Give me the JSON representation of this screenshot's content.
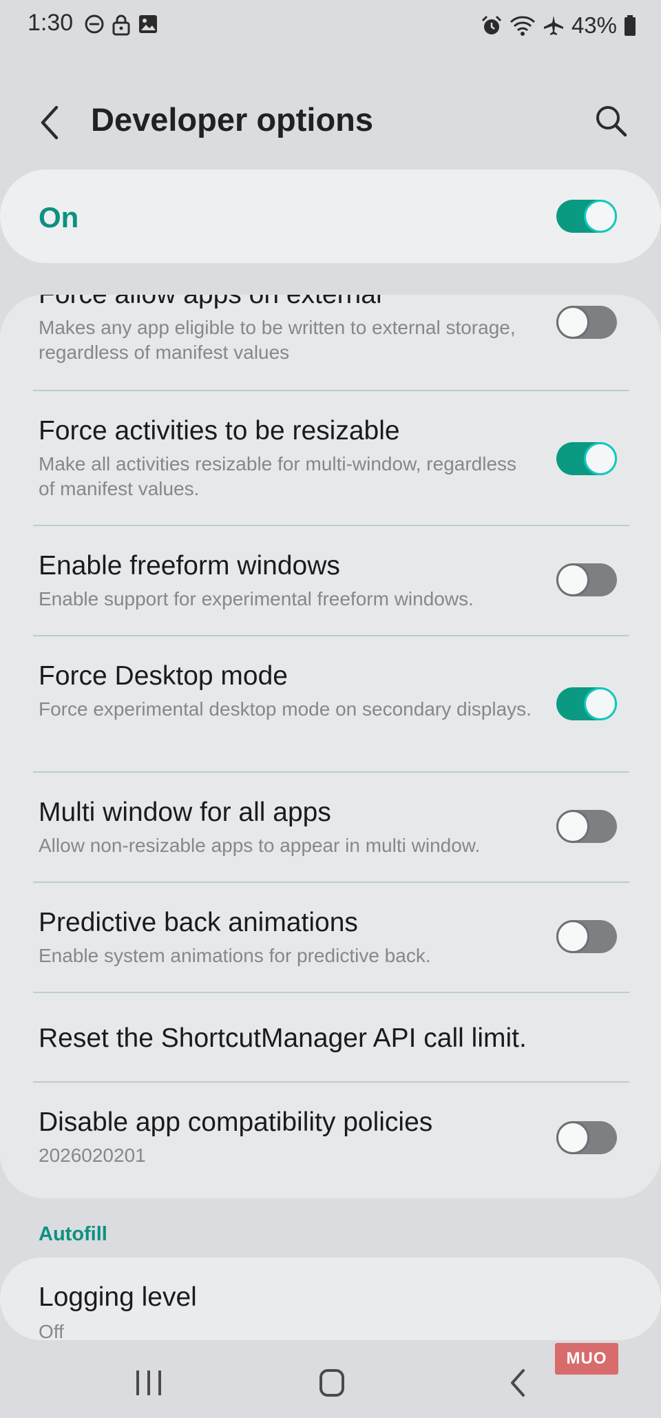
{
  "status_bar": {
    "time": "1:30",
    "battery": "43%"
  },
  "header": {
    "title": "Developer options"
  },
  "master": {
    "label": "On",
    "enabled": true
  },
  "settings": [
    {
      "title": "Force allow apps on external",
      "subtitle": "Makes any app eligible to be written to external storage, regardless of manifest values",
      "toggle": false
    },
    {
      "title": "Force activities to be resizable",
      "subtitle": "Make all activities resizable for multi-window, regardless of manifest values.",
      "toggle": true
    },
    {
      "title": "Enable freeform windows",
      "subtitle": "Enable support for experimental freeform windows.",
      "toggle": false
    },
    {
      "title": "Force Desktop mode",
      "subtitle": "Force experimental desktop mode on secondary displays.",
      "toggle": true
    },
    {
      "title": "Multi window for all apps",
      "subtitle": "Allow non-resizable apps to appear in multi window.",
      "toggle": false
    },
    {
      "title": "Predictive back animations",
      "subtitle": "Enable system animations for predictive back.",
      "toggle": false
    },
    {
      "title": "Reset the ShortcutManager API call limit."
    },
    {
      "title": "Disable app compatibility policies",
      "subtitle": "2026020201",
      "toggle": false
    }
  ],
  "autofill": {
    "header": "Autofill",
    "logging": {
      "title": "Logging level",
      "value": "Off"
    }
  },
  "watermark": "MUO",
  "colors": {
    "accent": "#0b9181",
    "toggle_on": "#0a9a82",
    "toggle_off": "#7e7f83"
  }
}
